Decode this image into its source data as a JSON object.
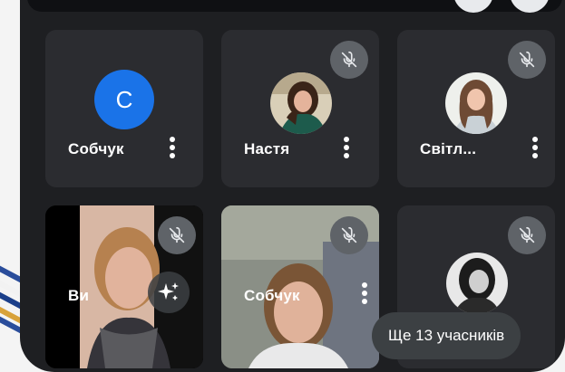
{
  "participants": [
    {
      "id": "p1",
      "name": "Собчук",
      "avatar_letter": "С",
      "avatar_color": "#1a73e8",
      "muted": false,
      "menu_icon": "more-vert-icon"
    },
    {
      "id": "p2",
      "name": "Настя",
      "muted": true,
      "menu_icon": "more-vert-icon",
      "mute_icon": "mic-off-icon"
    },
    {
      "id": "p3",
      "name": "Світл...",
      "muted": true,
      "menu_icon": "more-vert-icon",
      "mute_icon": "mic-off-icon"
    },
    {
      "id": "p4",
      "name": "Ви",
      "muted": true,
      "effects_icon": "sparkle-effects-icon",
      "mute_icon": "mic-off-icon"
    },
    {
      "id": "p5",
      "name": "Собчук",
      "muted": true,
      "menu_icon": "more-vert-icon",
      "mute_icon": "mic-off-icon"
    },
    {
      "id": "p6",
      "muted": true,
      "mute_icon": "mic-off-icon"
    }
  ],
  "more_participants_label": "Ще 13 учасників",
  "colors": {
    "background": "#1e1f22",
    "tile": "#2b2c30",
    "mute_badge": "#5f6368",
    "avatar_blue": "#1a73e8",
    "pill": "#3c4043"
  }
}
